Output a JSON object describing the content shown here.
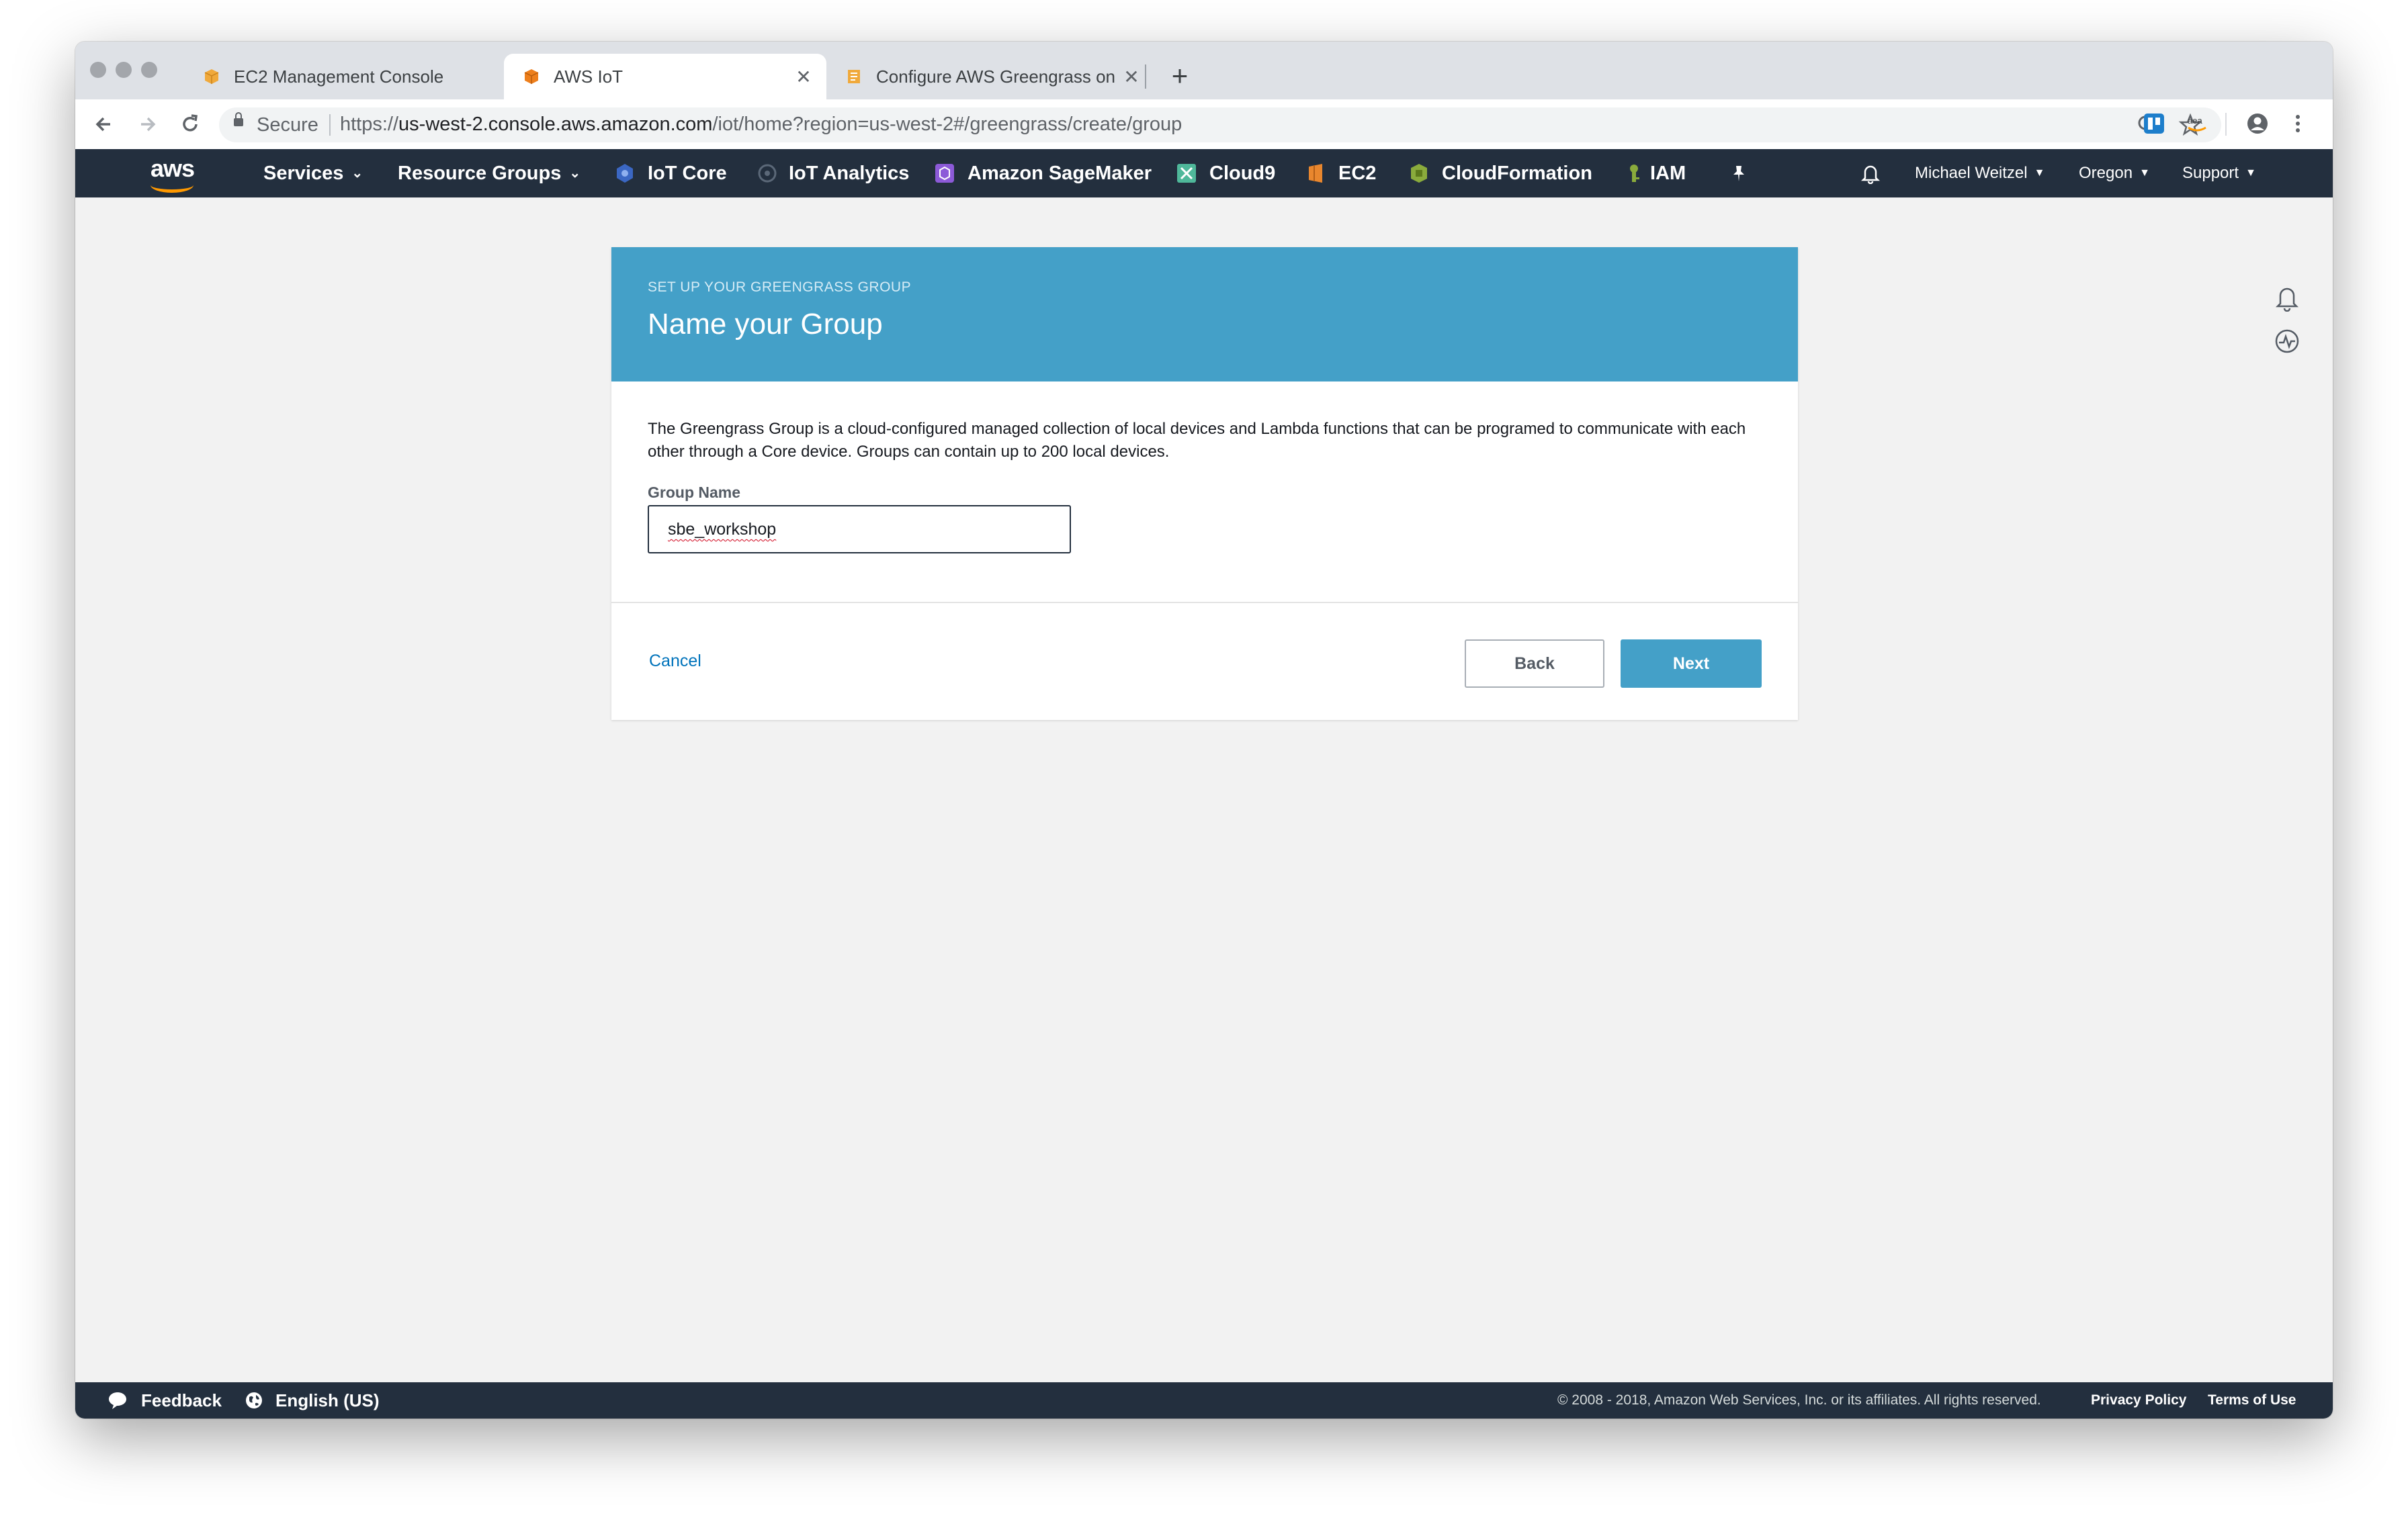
{
  "browser": {
    "tabs": [
      {
        "title": "EC2 Management Console",
        "active": false,
        "favicon_color": "#f0a93b"
      },
      {
        "title": "AWS IoT",
        "active": true,
        "favicon_color": "#ed7f1c"
      },
      {
        "title": "Configure AWS Greengrass on",
        "active": false,
        "favicon_color": "#f0a93b"
      }
    ],
    "tab_close_glyph": "✕",
    "new_tab_glyph": "+",
    "secure_label": "Secure",
    "url_scheme": "https://",
    "url_host": "us-west-2.console.aws.amazon.com",
    "url_path": "/iot/home?region=us-west-2#/greengrass/create/group"
  },
  "aws_nav": {
    "logo_text": "aws",
    "services_label": "Services",
    "resource_groups_label": "Resource Groups",
    "shortcuts": [
      {
        "label": "IoT Core",
        "icon": "iot-core-icon",
        "color": "#3b67c3"
      },
      {
        "label": "IoT Analytics",
        "icon": "iot-analytics-icon",
        "color": "#556270"
      },
      {
        "label": "Amazon SageMaker",
        "icon": "sagemaker-icon",
        "color": "#8c5ad8"
      },
      {
        "label": "Cloud9",
        "icon": "cloud9-icon",
        "color": "#4fb89a"
      },
      {
        "label": "EC2",
        "icon": "ec2-icon",
        "color": "#e9872e"
      },
      {
        "label": "CloudFormation",
        "icon": "cloudformation-icon",
        "color": "#8aab3c"
      },
      {
        "label": "IAM",
        "icon": "iam-icon",
        "color": "#8aab3c"
      }
    ],
    "user_label": "Michael Weitzel",
    "region_label": "Oregon",
    "support_label": "Support"
  },
  "wizard": {
    "eyebrow": "SET UP YOUR GREENGRASS GROUP",
    "title": "Name your Group",
    "description": "The Greengrass Group is a cloud-configured managed collection of local devices and Lambda functions that can be programed to communicate with each other through a Core device. Groups can contain up to 200 local devices.",
    "group_name_label": "Group Name",
    "group_name_value": "sbe_workshop",
    "cancel_label": "Cancel",
    "back_label": "Back",
    "next_label": "Next"
  },
  "footer": {
    "feedback_label": "Feedback",
    "language_label": "English (US)",
    "copyright": "© 2008 - 2018, Amazon Web Services, Inc. or its affiliates. All rights reserved.",
    "privacy_label": "Privacy Policy",
    "terms_label": "Terms of Use"
  },
  "colors": {
    "nav_bg": "#232f3e",
    "header_blue": "#44a0c8",
    "link_blue": "#0073bb",
    "aws_orange": "#ff9900"
  }
}
